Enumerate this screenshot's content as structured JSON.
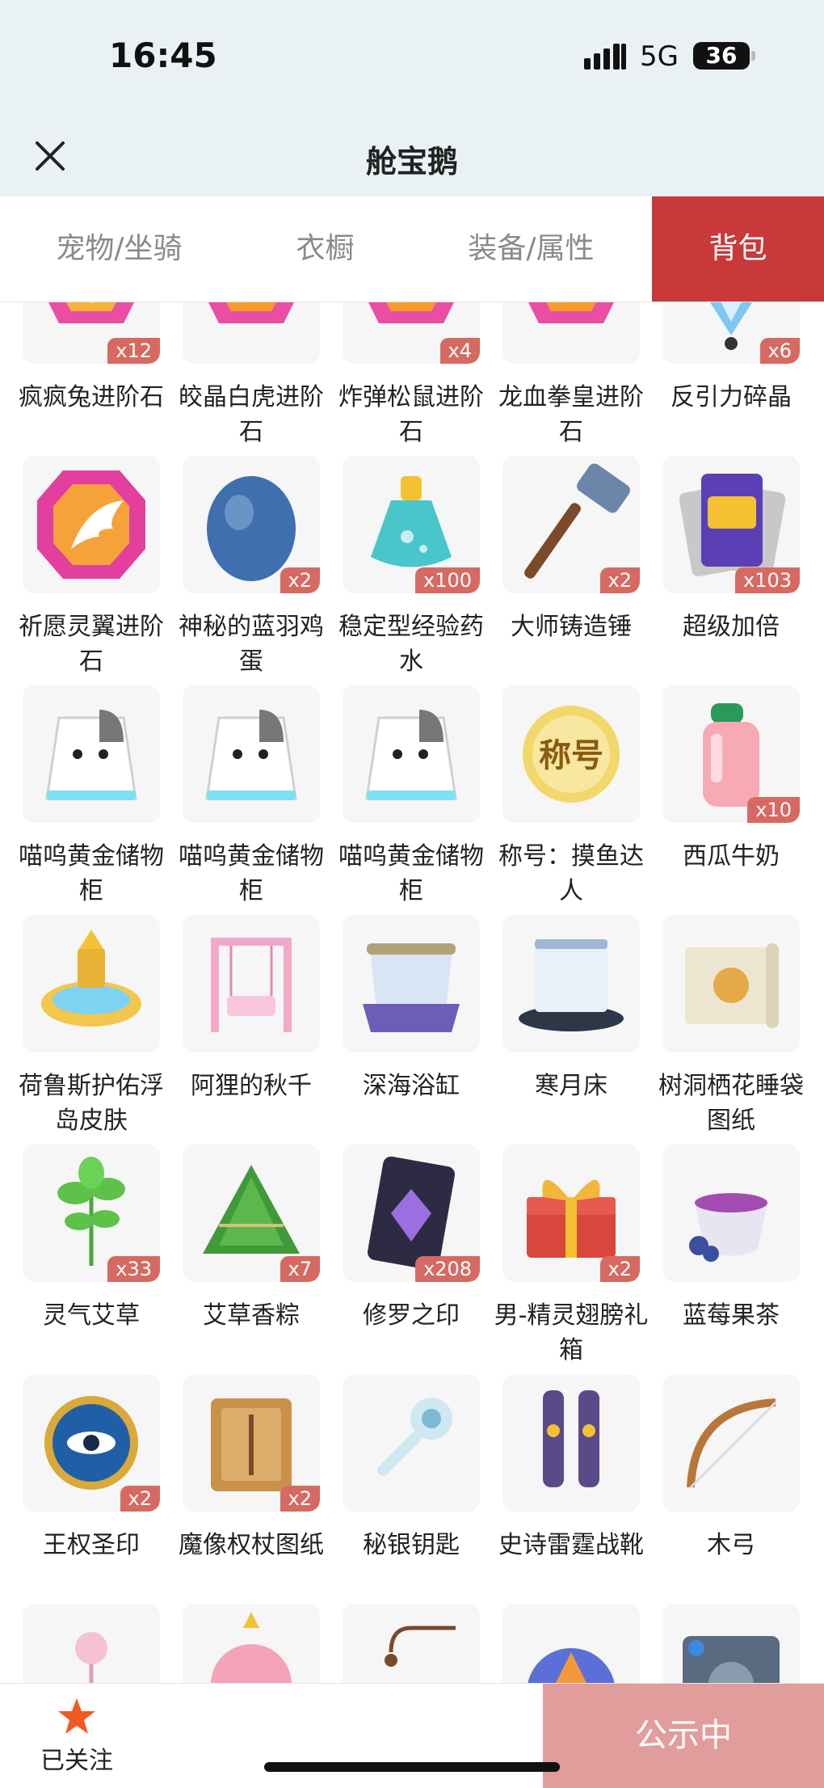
{
  "status_bar": {
    "time": "16:45",
    "network": "5G",
    "battery": "36"
  },
  "header": {
    "title": "舱宝鹅"
  },
  "tabs": [
    {
      "label": "宠物/坐骑",
      "active": false
    },
    {
      "label": "衣橱",
      "active": false
    },
    {
      "label": "装备/属性",
      "active": false
    },
    {
      "label": "背包",
      "active": true
    }
  ],
  "items": [
    {
      "name": "疯疯兔进阶石",
      "count": "x12",
      "icon": "gem-heart-icon"
    },
    {
      "name": "皎晶白虎进阶石",
      "count": "",
      "icon": "gem-orange-icon"
    },
    {
      "name": "炸弹松鼠进阶石",
      "count": "x4",
      "icon": "gem-orange-icon"
    },
    {
      "name": "龙血拳皇进阶石",
      "count": "",
      "icon": "gem-orange-icon"
    },
    {
      "name": "反引力碎晶",
      "count": "x6",
      "icon": "crystal-icon"
    },
    {
      "name": "祈愿灵翼进阶石",
      "count": "",
      "icon": "gem-wing-icon"
    },
    {
      "name": "神秘的蓝羽鸡蛋",
      "count": "x2",
      "icon": "blue-egg-icon"
    },
    {
      "name": "稳定型经验药水",
      "count": "x100",
      "icon": "potion-icon"
    },
    {
      "name": "大师铸造锤",
      "count": "x2",
      "icon": "hammer-icon"
    },
    {
      "name": "超级加倍",
      "count": "x103",
      "icon": "cards-icon"
    },
    {
      "name": "喵呜黄金储物柜",
      "count": "",
      "icon": "cat-cabinet-icon"
    },
    {
      "name": "喵呜黄金储物柜",
      "count": "",
      "icon": "cat-cabinet-icon"
    },
    {
      "name": "喵呜黄金储物柜",
      "count": "",
      "icon": "cat-cabinet-icon"
    },
    {
      "name": "称号：摸鱼达人",
      "count": "",
      "icon": "title-badge-icon",
      "icon_text": "称号"
    },
    {
      "name": "西瓜牛奶",
      "count": "x10",
      "icon": "milk-bottle-icon"
    },
    {
      "name": "荷鲁斯护佑浮岛皮肤",
      "count": "",
      "icon": "floating-island-icon"
    },
    {
      "name": "阿狸的秋千",
      "count": "",
      "icon": "swing-icon"
    },
    {
      "name": "深海浴缸",
      "count": "",
      "icon": "bathtub-icon"
    },
    {
      "name": "寒月床",
      "count": "",
      "icon": "bed-icon"
    },
    {
      "name": "树洞栖花睡袋图纸",
      "count": "",
      "icon": "blueprint-icon"
    },
    {
      "name": "灵气艾草",
      "count": "x33",
      "icon": "herb-icon"
    },
    {
      "name": "艾草香粽",
      "count": "x7",
      "icon": "zongzi-icon"
    },
    {
      "name": "修罗之印",
      "count": "x208",
      "icon": "dark-card-icon"
    },
    {
      "name": "男-精灵翅膀礼箱",
      "count": "x2",
      "icon": "gift-chest-icon"
    },
    {
      "name": "蓝莓果茶",
      "count": "",
      "icon": "tea-cup-icon"
    },
    {
      "name": "王权圣印",
      "count": "x2",
      "icon": "eye-seal-icon"
    },
    {
      "name": "魔像权杖图纸",
      "count": "x2",
      "icon": "scroll-icon"
    },
    {
      "name": "秘银钥匙",
      "count": "",
      "icon": "key-icon"
    },
    {
      "name": "史诗雷霆战靴",
      "count": "",
      "icon": "boots-icon"
    },
    {
      "name": "木弓",
      "count": "",
      "icon": "bow-icon"
    },
    {
      "name": "",
      "count": "",
      "icon": "lollipop-icon"
    },
    {
      "name": "",
      "count": "",
      "icon": "sticker-icon"
    },
    {
      "name": "",
      "count": "",
      "icon": "lamp-icon"
    },
    {
      "name": "",
      "count": "",
      "icon": "orb-icon"
    },
    {
      "name": "",
      "count": "",
      "icon": "safe-icon"
    }
  ],
  "bottom_bar": {
    "follow_label": "已关注",
    "publish_label": "公示中"
  },
  "colors": {
    "accent": "#c9393a",
    "badge": "#d66a62",
    "publish": "#e19d9b",
    "follow_star": "#f05a22"
  }
}
